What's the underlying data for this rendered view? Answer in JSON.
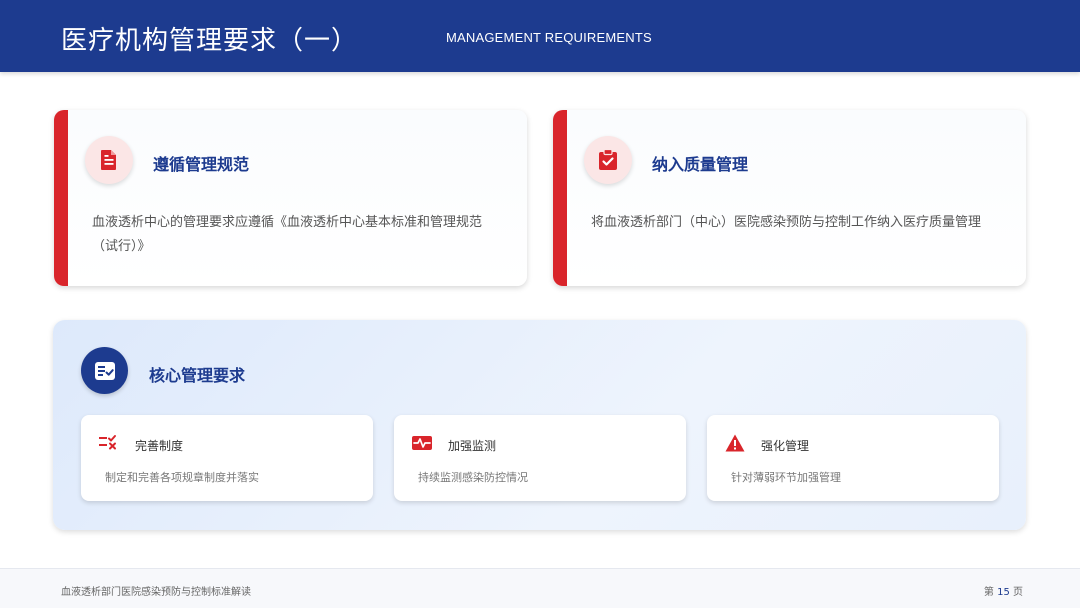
{
  "header": {
    "title": "医疗机构管理要求（一）",
    "subtitle": "MANAGEMENT REQUIREMENTS"
  },
  "cards": [
    {
      "icon": "document-icon",
      "title": "遵循管理规范",
      "desc": "血液透析中心的管理要求应遵循《血液透析中心基本标准和管理规范（试行）》"
    },
    {
      "icon": "clipboard-check-icon",
      "title": "纳入质量管理",
      "desc": "将血液透析部门（中心）医院感染预防与控制工作纳入医疗质量管理"
    }
  ],
  "core": {
    "icon": "checklist-icon",
    "title": "核心管理要求",
    "items": [
      {
        "icon": "list-check-icon",
        "title": "完善制度",
        "desc": "制定和完善各项规章制度并落实"
      },
      {
        "icon": "monitor-wave-icon",
        "title": "加强监测",
        "desc": "持续监测感染防控情况"
      },
      {
        "icon": "warning-icon",
        "title": "强化管理",
        "desc": "针对薄弱环节加强管理"
      }
    ]
  },
  "footer": {
    "left": "血液透析部门医院感染预防与控制标准解读",
    "page_prefix": "第",
    "page_number": "15",
    "page_suffix": "页"
  },
  "colors": {
    "primary": "#1d3b8f",
    "accent": "#d9252b"
  }
}
